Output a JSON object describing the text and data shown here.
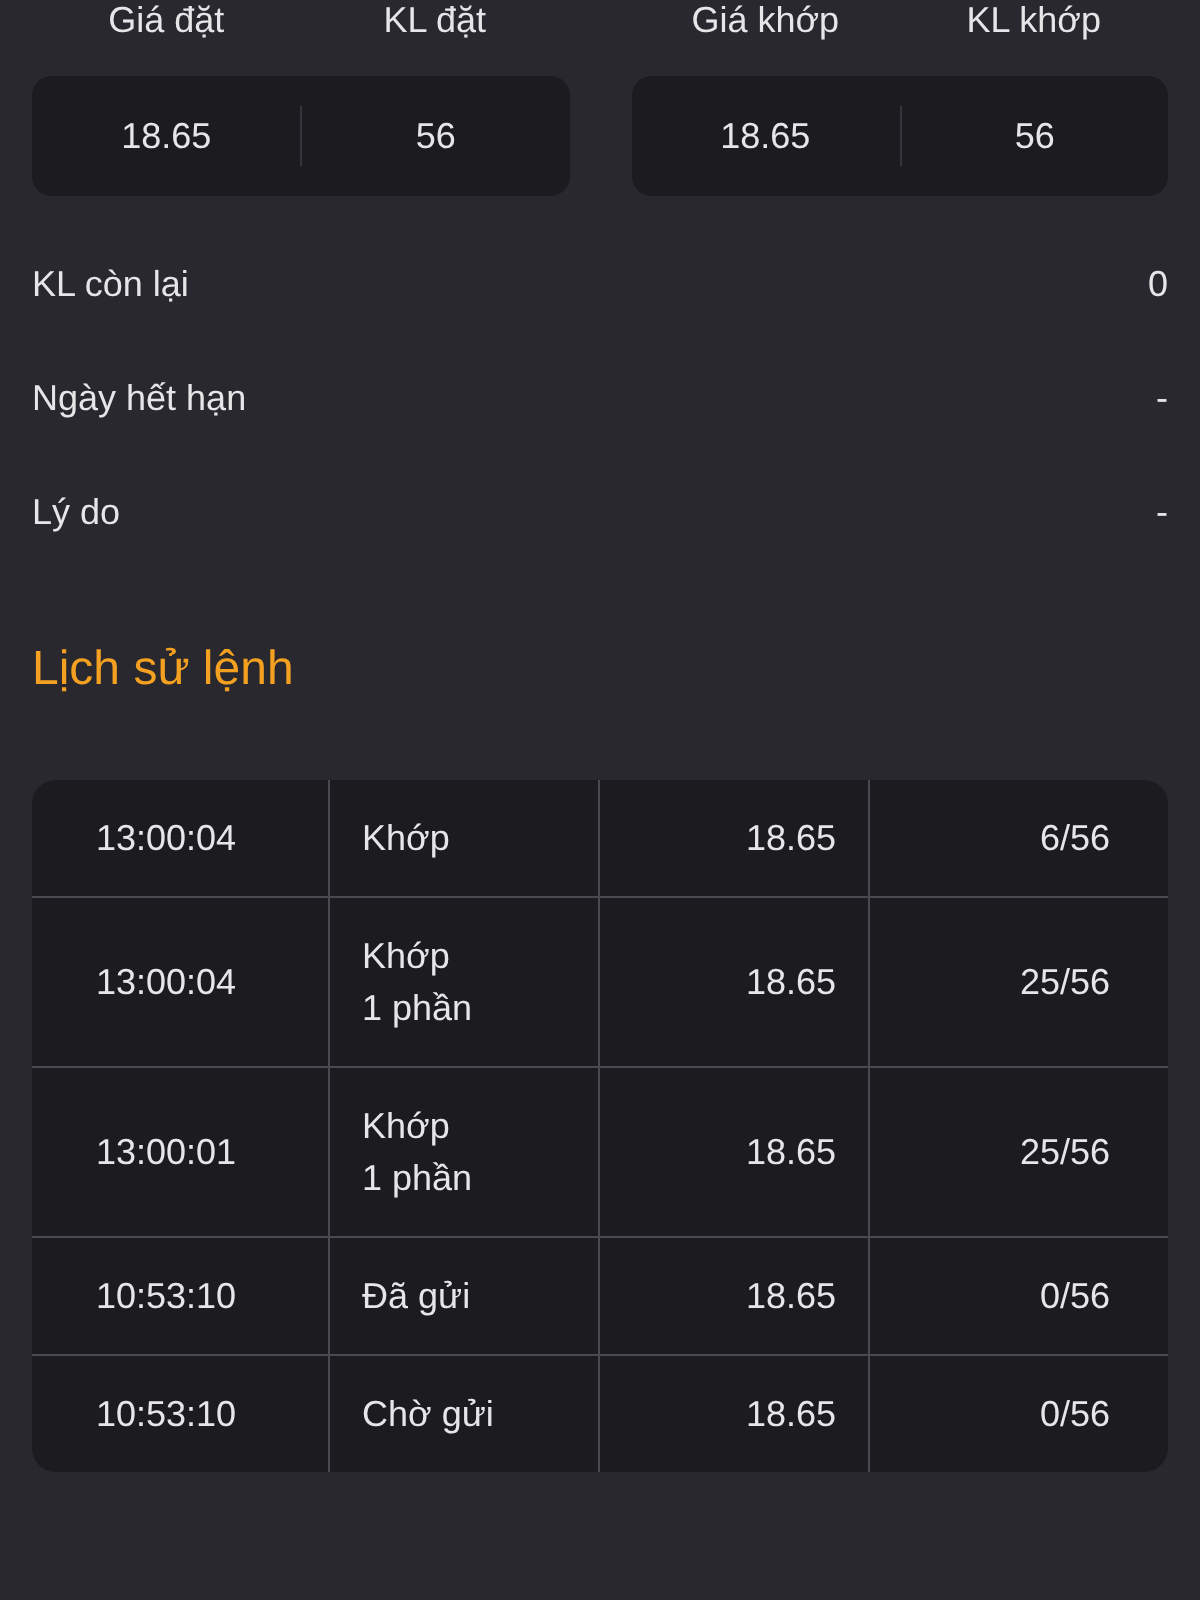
{
  "summary_cards": [
    {
      "fields": [
        {
          "label": "Giá đặt",
          "value": "18.65"
        },
        {
          "label": "KL đặt",
          "value": "56"
        }
      ]
    },
    {
      "fields": [
        {
          "label": "Giá khớp",
          "value": "18.65"
        },
        {
          "label": "KL khớp",
          "value": "56"
        }
      ]
    }
  ],
  "details": [
    {
      "label": "KL còn lại",
      "value": "0"
    },
    {
      "label": "Ngày hết hạn",
      "value": "-"
    },
    {
      "label": "Lý do",
      "value": "-"
    }
  ],
  "history": {
    "title": "Lịch sử lệnh",
    "rows": [
      {
        "time": "13:00:04",
        "status": "Khớp",
        "price": "18.65",
        "quantity": "6/56"
      },
      {
        "time": "13:00:04",
        "status": "Khớp 1 phần",
        "price": "18.65",
        "quantity": "25/56"
      },
      {
        "time": "13:00:01",
        "status": "Khớp 1 phần",
        "price": "18.65",
        "quantity": "25/56"
      },
      {
        "time": "10:53:10",
        "status": "Đã gửi",
        "price": "18.65",
        "quantity": "0/56"
      },
      {
        "time": "10:53:10",
        "status": "Chờ gửi",
        "price": "18.65",
        "quantity": "0/56"
      }
    ]
  }
}
